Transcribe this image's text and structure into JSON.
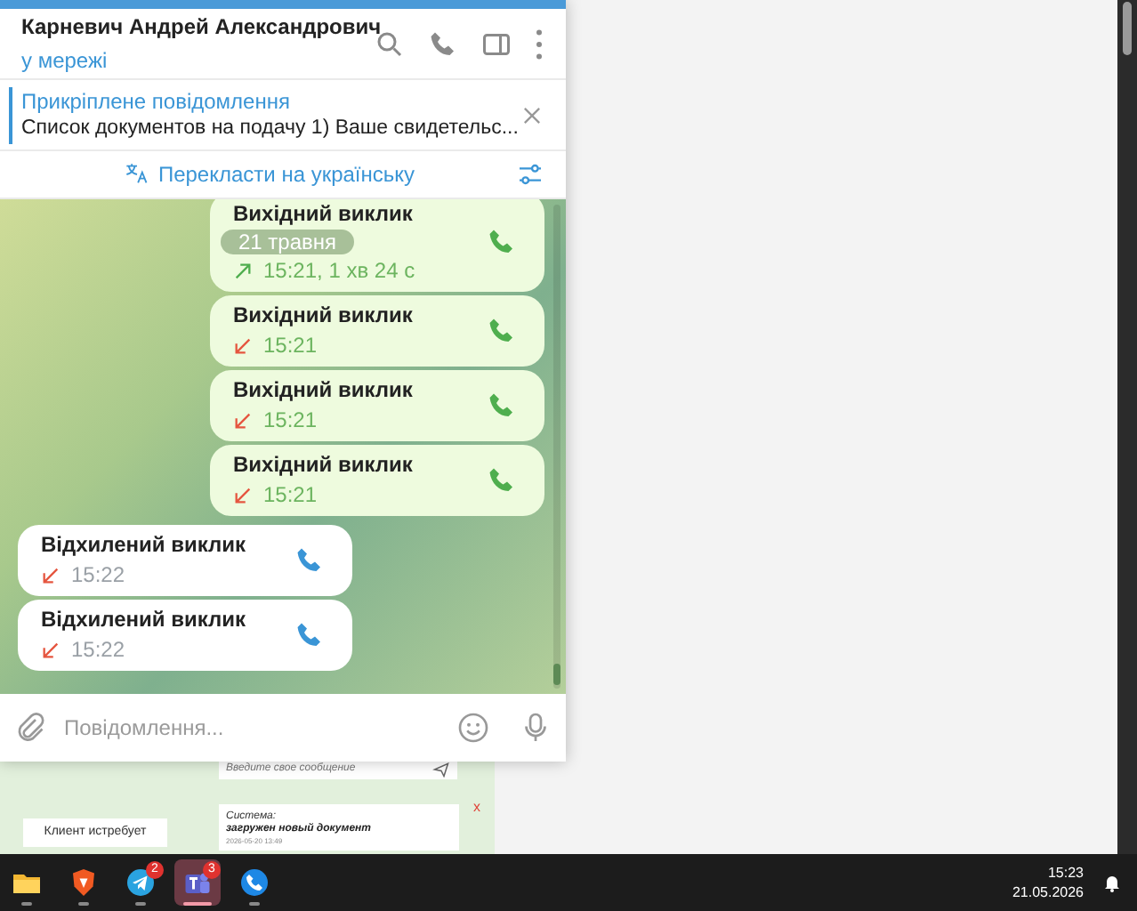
{
  "chat_header": {
    "name": "Карневич Андрей Александрович",
    "status": "у мережі"
  },
  "pinned": {
    "title": "Прикріплене повідомлення",
    "text": "Список документов на подачу  1) Ваше свидетельс..."
  },
  "translate_bar": {
    "label": "Перекласти на українську"
  },
  "date_pill": "21 травня",
  "messages": [
    {
      "kind": "outgoing",
      "title": "Вихідний виклик",
      "meta": "15:21, 1 хв 24 с",
      "missed": false
    },
    {
      "kind": "outgoing",
      "title": "Вихідний виклик",
      "meta": "15:21",
      "missed": true
    },
    {
      "kind": "outgoing",
      "title": "Вихідний виклик",
      "meta": "15:21",
      "missed": true
    },
    {
      "kind": "outgoing",
      "title": "Вихідний виклик",
      "meta": "15:21",
      "missed": true
    },
    {
      "kind": "incoming",
      "title": "Відхилений виклик",
      "meta": "15:22",
      "missed": true
    },
    {
      "kind": "incoming",
      "title": "Відхилений виклик",
      "meta": "15:22",
      "missed": true
    }
  ],
  "composer": {
    "placeholder": "Повідомлення..."
  },
  "background_app": {
    "message_placeholder": "Введите свое сообщение",
    "client_label": "Клиент истребует",
    "system_sender": "Система:",
    "system_text": "загружен новый документ",
    "system_time": "2026-05-20 13:49",
    "close_mark": "x"
  },
  "taskbar": {
    "apps": [
      {
        "kind": "folder",
        "selected": false
      },
      {
        "kind": "browser",
        "selected": false
      },
      {
        "kind": "telegram",
        "badge": "2",
        "selected": false
      },
      {
        "kind": "teams",
        "badge": "3",
        "selected": true
      },
      {
        "kind": "phone",
        "selected": false
      }
    ],
    "time": "15:23",
    "date": "21.05.2026"
  }
}
